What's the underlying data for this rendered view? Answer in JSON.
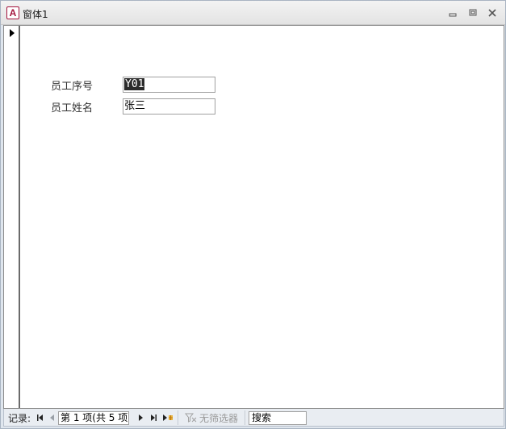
{
  "window": {
    "icon_letter": "A",
    "title": "窗体1",
    "minimize_icon": "minimize-icon",
    "restore_icon": "restore-icon",
    "close_icon": "close-icon"
  },
  "form": {
    "fields": [
      {
        "label": "员工序号",
        "value": "Y01",
        "selected": true
      },
      {
        "label": "员工姓名",
        "value": "张三",
        "selected": false
      }
    ]
  },
  "navigation": {
    "record_label": "记录:",
    "current_record": "第 1 项(共 5 项)",
    "filter_label": "无筛选器",
    "search_label": "搜索"
  },
  "colors": {
    "accent": "#a4133c",
    "selection": "#2b2b2b"
  }
}
